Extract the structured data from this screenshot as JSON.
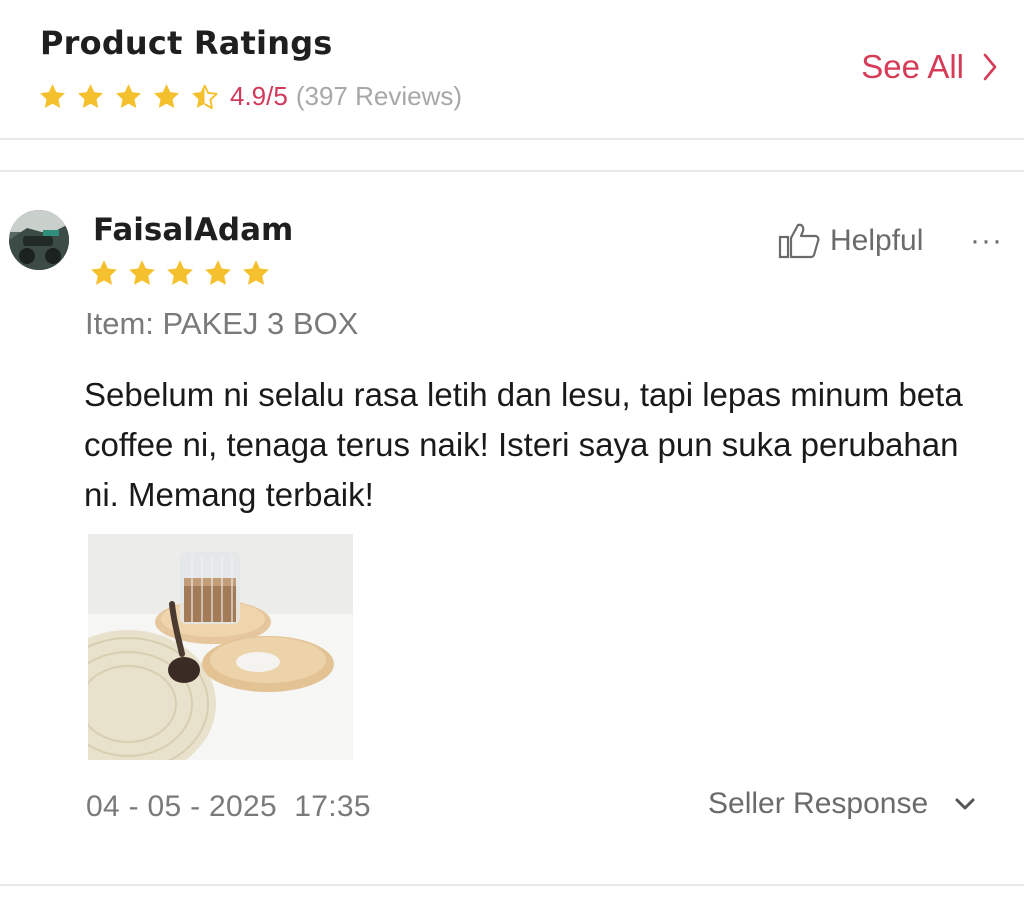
{
  "header": {
    "title": "Product Ratings",
    "rating_text": "4.9/5",
    "review_count": "(397 Reviews)",
    "rating_value": 4.5,
    "see_all": "See All"
  },
  "review": {
    "username": "FaisalAdam",
    "stars": 5,
    "helpful_label": "Helpful",
    "more_label": "···",
    "item_variant": "Item: PAKEJ 3 BOX",
    "text": "Sebelum ni selalu rasa letih dan lesu, tapi lepas minum beta coffee ni, tenaga terus naik! Isteri saya pun suka perubahan ni. Memang terbaik!",
    "date": "04 - 05 - 2025  17:35",
    "seller_response_label": "Seller Response"
  },
  "colors": {
    "accent": "#d63b57",
    "star": "#f5c02e",
    "muted_text": "#7a7a7a",
    "divider": "#e9e9e9"
  },
  "icons": [
    "star-icon",
    "chevron-right-icon",
    "thumbs-up-icon",
    "more-dots-icon",
    "chevron-down-icon"
  ]
}
